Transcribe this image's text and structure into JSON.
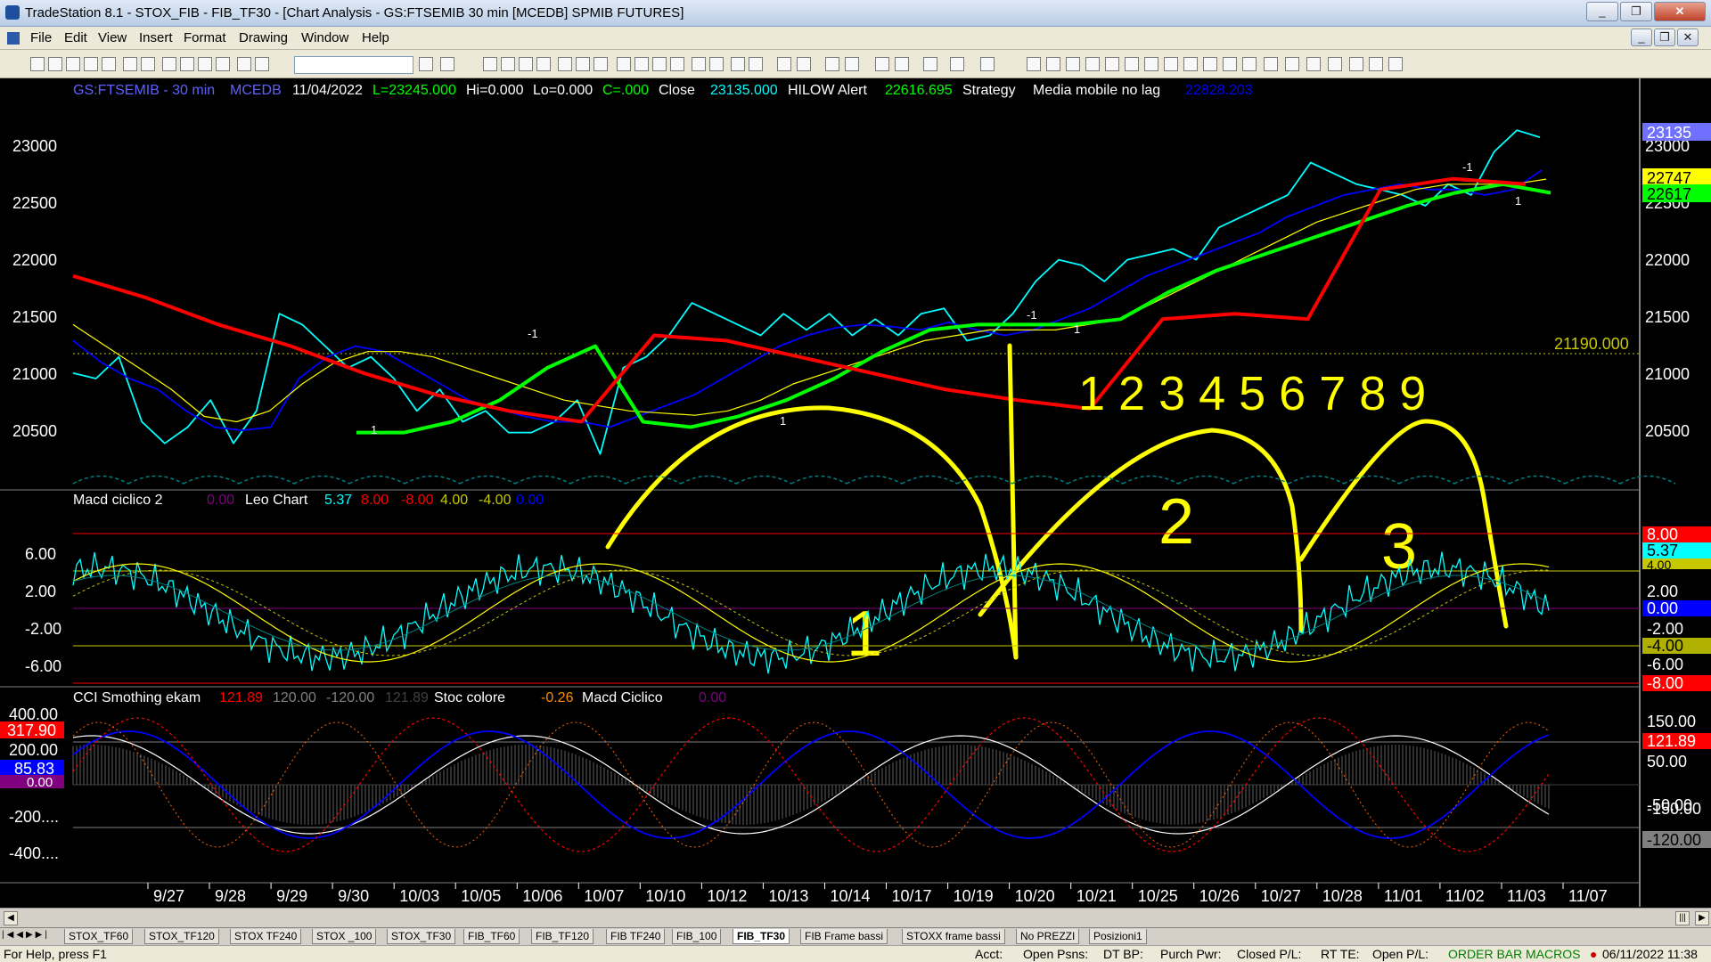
{
  "window": {
    "title": "TradeStation 8.1 - STOX_FIB - FIB_TF30 - [Chart Analysis - GS:FTSEMIB  30 min  [MCEDB] SPMIB FUTURES]",
    "minimize": "_",
    "restore": "❐",
    "close": "✕"
  },
  "menu": [
    "File",
    "Edit",
    "View",
    "Insert",
    "Format",
    "Drawing",
    "Window",
    "Help"
  ],
  "statusline": {
    "symbol": "GS:FTSEMIB - 30 min",
    "source": "MCEDB",
    "date": "11/04/2022",
    "last": "L=23245.000",
    "hi": "Hi=0.000",
    "lo": "Lo=0.000",
    "change": "C=.000",
    "close_label": "Close",
    "close_value": "23135.000",
    "alert_label": "HILOW Alert",
    "alert_value": "22616.695",
    "strategy_label": "Strategy",
    "ma_label": "Media mobile no lag",
    "ma_value": "22828.203"
  },
  "price_axis": {
    "ticks": [
      "23000",
      "22500",
      "22000",
      "21500",
      "21000",
      "20500"
    ],
    "markers": [
      {
        "text": "23135",
        "color": "#7070ff"
      },
      {
        "text": "22747",
        "color": "#ffff00"
      },
      {
        "text": "22617",
        "color": "#00ff00"
      }
    ],
    "hline_label": "21190.000"
  },
  "annotations": {
    "digits": "1 2 3 4 5 6 7 8 9",
    "cycles": [
      "1",
      "2",
      "3"
    ]
  },
  "macd_panel": {
    "title": "Macd ciclico 2",
    "v1": "0.00",
    "leo_label": "Leo Chart",
    "leo_value": "5.37",
    "p1": "8.00",
    "p2": "-8.00",
    "p3": "4.00",
    "p4": "-4.00",
    "p5": "0.00",
    "ticks": [
      "6.00",
      "2.00",
      "-2.00",
      "-6.00"
    ],
    "right_ticks": [
      "2.00",
      "-2.00",
      "-6.00"
    ],
    "markers": [
      {
        "text": "8.00",
        "color": "#ff0000"
      },
      {
        "text": "5.37",
        "color": "#00ffff"
      },
      {
        "text": "4.00",
        "color": "#c8c800"
      },
      {
        "text": "0.00",
        "color": "#0000ff"
      },
      {
        "text": "-4.00",
        "color": "#b0b000"
      },
      {
        "text": "-8.00",
        "color": "#ff0000"
      }
    ]
  },
  "cci_panel": {
    "title": "CCI Smothing ekam",
    "v1": "121.89",
    "v2": "120.00",
    "v3": "-120.00",
    "v4": "121.89",
    "stoc_label": "Stoc colore",
    "stoc_value": "-0.26",
    "macd_label": "Macd Ciclico",
    "macd_value": "0.00",
    "ticks": [
      "400.00",
      "200.00",
      "-200....",
      "-400...."
    ],
    "left_markers": [
      {
        "text": "317.90",
        "color": "#ff0000"
      },
      {
        "text": "85.83",
        "color": "#0000ff"
      },
      {
        "text": "0.00",
        "color": "#800080"
      }
    ],
    "right_ticks": [
      "150.00",
      "50.00",
      "-50.00",
      "-150.00"
    ],
    "right_markers": [
      {
        "text": "121.89",
        "color": "#ff0000"
      },
      {
        "text": "-120.00",
        "color": "#808080"
      }
    ]
  },
  "dates": [
    "9/27",
    "9/28",
    "9/29",
    "9/30",
    "10/03",
    "10/05",
    "10/06",
    "10/07",
    "10/10",
    "10/12",
    "10/13",
    "10/14",
    "10/17",
    "10/19",
    "10/20",
    "10/21",
    "10/25",
    "10/26",
    "10/27",
    "10/28",
    "11/01",
    "11/02",
    "11/03",
    "11/07"
  ],
  "chart_data": {
    "type": "line",
    "title": "GS:FTSEMIB - 30 min",
    "x_labels": [
      "9/27",
      "9/28",
      "9/29",
      "9/30",
      "10/03",
      "10/05",
      "10/06",
      "10/07",
      "10/10",
      "10/12",
      "10/13",
      "10/14",
      "10/17",
      "10/19",
      "10/20",
      "10/21",
      "10/25",
      "10/26",
      "10/27",
      "10/28",
      "11/01",
      "11/02",
      "11/03",
      "11/07"
    ],
    "ylim": [
      20050,
      23350
    ],
    "series": [
      {
        "color": "#00ffff",
        "values": [
          20950,
          20900,
          21100,
          20500,
          20300,
          20450,
          20700,
          20300,
          20600,
          21500,
          21400,
          21200,
          21000,
          21100,
          20900,
          20600,
          20800,
          20500,
          20600,
          20400,
          20400,
          20500,
          20700,
          20200,
          21000,
          21100,
          21300,
          21600,
          21500,
          21400,
          21300,
          21500,
          21350,
          21500,
          21300,
          21450,
          21300,
          21500,
          21550,
          21250,
          21300,
          21500,
          21800,
          22000,
          21950,
          21800,
          22000,
          22050,
          22100,
          22000,
          22300,
          22400,
          22500,
          22600,
          22900,
          22800,
          22700,
          22650,
          22600,
          22500,
          22700,
          22600,
          23000,
          23200,
          23135
        ]
      },
      {
        "color": "#0000ff",
        "values": [
          21250,
          21050,
          20900,
          20800,
          20600,
          20450,
          20420,
          20450,
          20900,
          21100,
          21200,
          21150,
          21000,
          20850,
          20700,
          20620,
          20550,
          20500,
          20500,
          20450,
          20550,
          20650,
          20750,
          20900,
          21050,
          21200,
          21300,
          21370,
          21400,
          21380,
          21350,
          21420,
          21350,
          21300,
          21350,
          21450,
          21550,
          21700,
          21850,
          21950,
          22050,
          22150,
          22250,
          22400,
          22500,
          22600,
          22650,
          22700,
          22650,
          22650,
          22600,
          22650,
          22830
        ]
      },
      {
        "color": "#ffff00",
        "values": [
          21400,
          21200,
          21000,
          20800,
          20550,
          20500,
          20600,
          20850,
          21050,
          21150,
          21150,
          21100,
          21000,
          20900,
          20800,
          20700,
          20650,
          20600,
          20580,
          20560,
          20600,
          20700,
          20850,
          20950,
          21050,
          21150,
          21250,
          21300,
          21350,
          21350,
          21350,
          21400,
          21450,
          21600,
          21750,
          21900,
          22050,
          22200,
          22350,
          22450,
          22550,
          22650,
          22700,
          22700,
          22700,
          22747
        ]
      },
      {
        "color": "#00ff00",
        "values": [
          20400,
          20400,
          20500,
          20700,
          21000,
          21200,
          20500,
          20450,
          20550,
          20700,
          20900,
          21150,
          21350,
          21400,
          21400,
          21400,
          21450,
          21700,
          21900,
          22050,
          22200,
          22350,
          22500,
          22620,
          22700,
          22620
        ]
      },
      {
        "color": "#ff0000",
        "values": [
          21850,
          21650,
          21400,
          21200,
          20950,
          20750,
          20600,
          20500,
          21300,
          21250,
          21100,
          20950,
          20800,
          20700,
          20620,
          21450,
          21500,
          21450,
          22650,
          22750,
          22700
        ]
      }
    ]
  }
}
